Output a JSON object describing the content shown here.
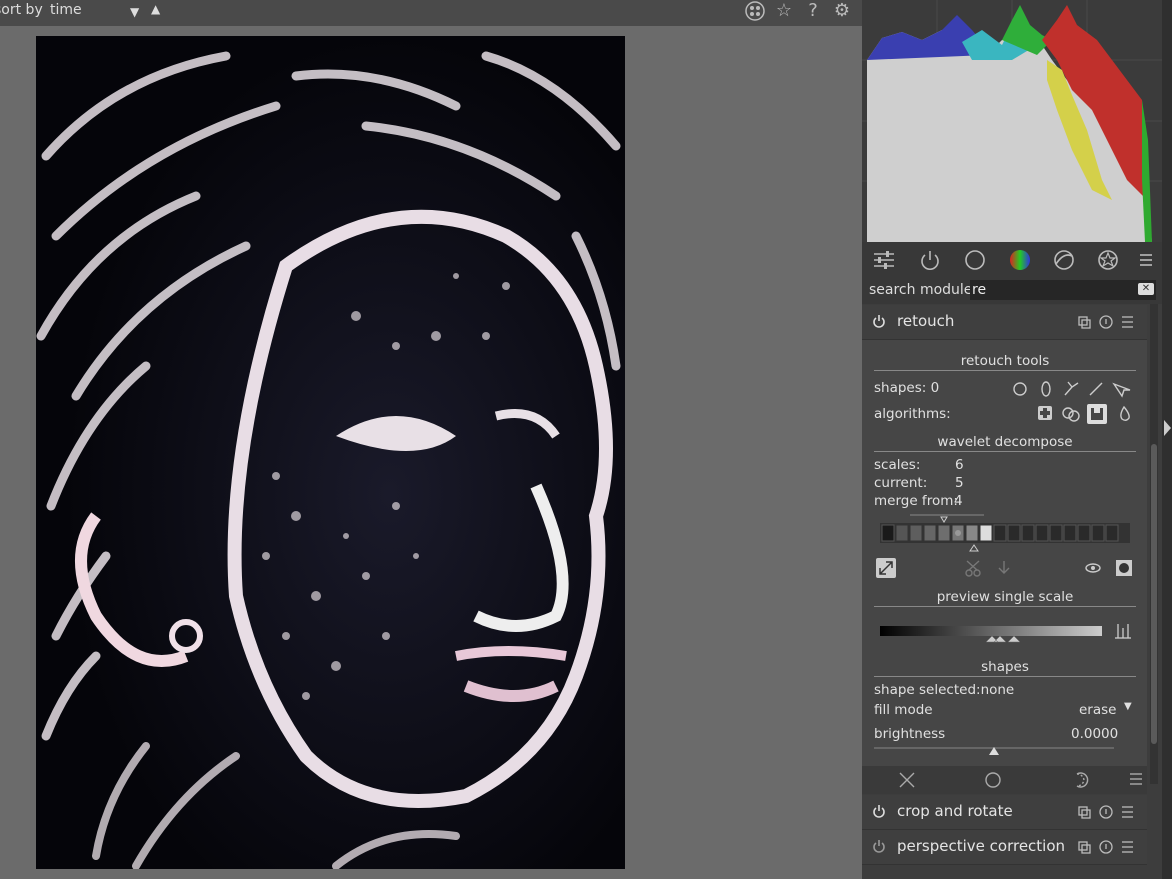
{
  "topbar": {
    "sort_label": "sort by",
    "sort_value": "time",
    "icons": [
      "grid-icon",
      "star-icon",
      "help-icon",
      "gear-icon"
    ]
  },
  "image_view": {
    "description_icon": "photo"
  },
  "modules_panel": {
    "group_icons": [
      "sliders-icon",
      "power-icon",
      "circle-icon",
      "color-icon",
      "correct-icon",
      "effect-icon",
      "menu-icon"
    ],
    "search": {
      "label": "search module",
      "value": "re"
    },
    "retouch": {
      "title": "retouch",
      "retouch_tools": "retouch tools",
      "shapes_label": "shapes: 0",
      "algorithms_label": "algorithms:",
      "wavelet": "wavelet decompose",
      "scales_label": "scales:",
      "scales_value": "6",
      "current_label": "current:",
      "current_value": "5",
      "merge_label": "merge from:",
      "merge_value": "4",
      "preview": "preview single scale",
      "shapes_section": "shapes",
      "shape_selected": "shape selected:none",
      "fill_mode_label": "fill mode",
      "fill_mode_value": "erase",
      "brightness_label": "brightness",
      "brightness_value": "0.0000"
    },
    "other_modules": [
      "crop and rotate",
      "perspective correction"
    ]
  },
  "colors": {
    "panel": "#3d3d3d",
    "accent": "#ffffff"
  }
}
